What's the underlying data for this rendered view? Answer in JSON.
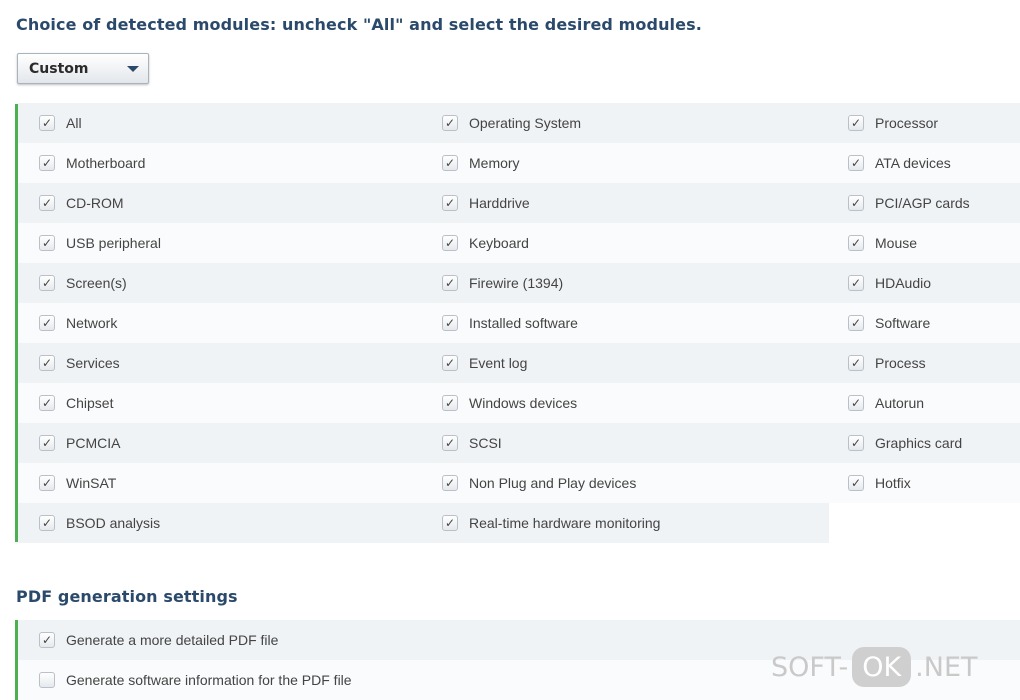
{
  "heading_modules": "Choice of detected modules: uncheck \"All\" and select the desired modules.",
  "preset_select": {
    "value": "Custom"
  },
  "modules": [
    [
      "All",
      "Operating System",
      "Processor"
    ],
    [
      "Motherboard",
      "Memory",
      "ATA devices"
    ],
    [
      "CD-ROM",
      "Harddrive",
      "PCI/AGP cards"
    ],
    [
      "USB peripheral",
      "Keyboard",
      "Mouse"
    ],
    [
      "Screen(s)",
      "Firewire (1394)",
      "HDAudio"
    ],
    [
      "Network",
      "Installed software",
      "Software"
    ],
    [
      "Services",
      "Event log",
      "Process"
    ],
    [
      "Chipset",
      "Windows devices",
      "Autorun"
    ],
    [
      "PCMCIA",
      "SCSI",
      "Graphics card"
    ],
    [
      "WinSAT",
      "Non Plug and Play devices",
      "Hotfix"
    ],
    [
      "BSOD analysis",
      "Real-time hardware monitoring"
    ]
  ],
  "checkbox_mark": "✓",
  "heading_pdf": "PDF generation settings",
  "pdf_options": [
    {
      "label": "Generate a more detailed PDF file",
      "checked": true
    },
    {
      "label": "Generate software information for the PDF file",
      "checked": false
    }
  ],
  "watermark": {
    "left": "SOFT-",
    "ok": "OK",
    "right": ".NET"
  },
  "colors": {
    "accent_bar": "#4caf50",
    "heading": "#2b4a6b"
  }
}
